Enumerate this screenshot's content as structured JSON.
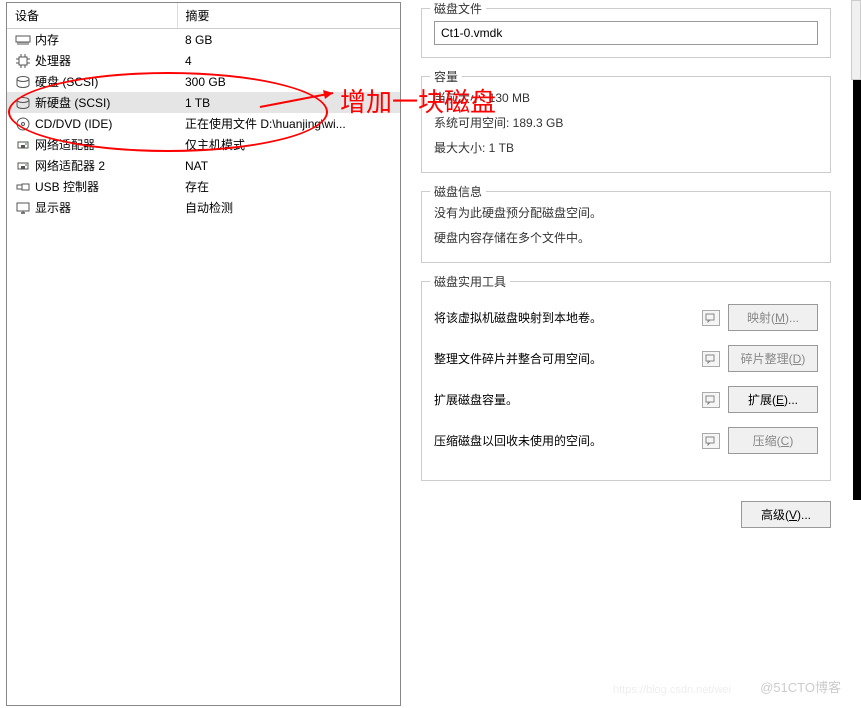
{
  "left": {
    "header_device": "设备",
    "header_summary": "摘要",
    "rows": [
      {
        "icon": "memory-icon",
        "name": "内存",
        "summary": "8 GB"
      },
      {
        "icon": "cpu-icon",
        "name": "处理器",
        "summary": "4"
      },
      {
        "icon": "disk-icon",
        "name": "硬盘 (SCSI)",
        "summary": "300 GB"
      },
      {
        "icon": "disk-icon",
        "name": "新硬盘 (SCSI)",
        "summary": "1 TB",
        "selected": true
      },
      {
        "icon": "cd-icon",
        "name": "CD/DVD (IDE)",
        "summary": "正在使用文件 D:\\huanjing\\wi..."
      },
      {
        "icon": "net-icon",
        "name": "网络适配器",
        "summary": "仅主机模式"
      },
      {
        "icon": "net-icon",
        "name": "网络适配器 2",
        "summary": "NAT"
      },
      {
        "icon": "usb-icon",
        "name": "USB 控制器",
        "summary": "存在"
      },
      {
        "icon": "display-icon",
        "name": "显示器",
        "summary": "自动检测"
      }
    ]
  },
  "right": {
    "disk_file": {
      "title": "磁盘文件",
      "value": "Ct1-0.vmdk"
    },
    "capacity": {
      "title": "容量",
      "current_size": "当前大小: 130 MB",
      "free_space": "系统可用空间: 189.3 GB",
      "max_size": "最大大小: 1 TB"
    },
    "disk_info": {
      "title": "磁盘信息",
      "line1": "没有为此硬盘预分配磁盘空间。",
      "line2": "硬盘内容存储在多个文件中。"
    },
    "utilities": {
      "title": "磁盘实用工具",
      "items": [
        {
          "text": "将该虚拟机磁盘映射到本地卷。",
          "btn": "映射(M)...",
          "key": "M",
          "disabled": true
        },
        {
          "text": "整理文件碎片并整合可用空间。",
          "btn": "碎片整理(D)",
          "key": "D",
          "disabled": true
        },
        {
          "text": "扩展磁盘容量。",
          "btn": "扩展(E)...",
          "key": "E",
          "disabled": false
        },
        {
          "text": "压缩磁盘以回收未使用的空间。",
          "btn": "压缩(C)",
          "key": "C",
          "disabled": true
        }
      ]
    },
    "advanced_btn": "高级(V)...",
    "advanced_key": "V"
  },
  "annotation": "增加一块磁盘",
  "watermark": "@51CTO博客",
  "watermark2": "https://blog.csdn.net/wei"
}
